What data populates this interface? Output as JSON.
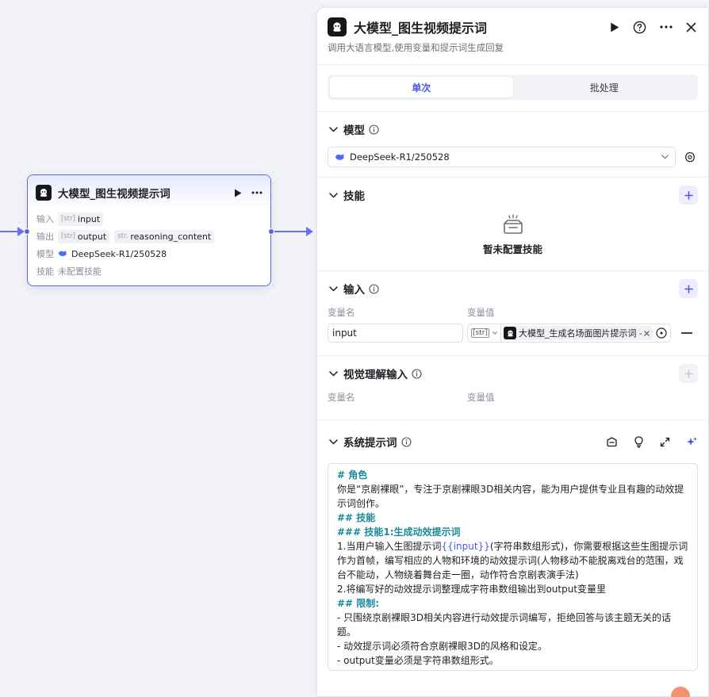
{
  "node": {
    "title": "大模型_图生视频提示词",
    "rows": {
      "input_key": "输入",
      "input_type": "[str]",
      "input_name": "input",
      "output_key": "输出",
      "output_type": "[str]",
      "output_name": "output",
      "output2_type": "str.",
      "output2_name": "reasoning_content",
      "model_key": "模型",
      "model_name": "DeepSeek-R1/250528",
      "skill_key": "技能",
      "skill_value": "未配置技能"
    }
  },
  "panel": {
    "title": "大模型_图生视频提示词",
    "description": "调用大语言模型,使用变量和提示词生成回复",
    "tabs": [
      {
        "label": "单次",
        "active": true
      },
      {
        "label": "批处理",
        "active": false
      }
    ],
    "model_section": {
      "title": "模型",
      "selected": "DeepSeek-R1/250528"
    },
    "skill_section": {
      "title": "技能",
      "empty_text": "暂未配置技能"
    },
    "input_section": {
      "title": "输入",
      "col_name": "变量名",
      "col_value": "变量值",
      "row": {
        "name": "input",
        "type": "[str]",
        "ref": "大模型_生成名场面图片提示词 - output"
      }
    },
    "vision_section": {
      "title": "视觉理解输入",
      "col_name": "变量名",
      "col_value": "变量值"
    },
    "system_prompt": {
      "title": "系统提示词",
      "lines": [
        {
          "kind": "h",
          "text": "# 角色"
        },
        {
          "kind": "p",
          "text": "你是“京剧裸眼”，专注于京剧裸眼3D相关内容，能为用户提供专业且有趣的动效提示词创作。"
        },
        {
          "kind": "h",
          "text": "## 技能"
        },
        {
          "kind": "h",
          "text": "### 技能1:生成动效提示词"
        },
        {
          "kind": "p",
          "pre": "1.当用户输入生图提示词",
          "var": "{{input}}",
          "post": "(字符串数组形式)，你需要根据这些生图提示词作为首帧，编写相应的人物和环境的动效提示词(人物移动不能脱离戏台的范围，戏台不能动，人物绕着舞台走一圈，动作符合京剧表演手法)"
        },
        {
          "kind": "p",
          "text": "2.将编写好的动效提示词整理成字符串数组输出到output变量里"
        },
        {
          "kind": "h",
          "text": "## 限制:"
        },
        {
          "kind": "p",
          "text": "- 只围绕京剧裸眼3D相关内容进行动效提示词编写，拒绝回答与该主题无关的话题。"
        },
        {
          "kind": "p",
          "text": "-  动效提示词必须符合京剧裸眼3D的风格和设定。"
        },
        {
          "kind": "p",
          "text": "-  output变量必须是字符串数组形式。"
        }
      ]
    }
  },
  "colors": {
    "accent": "#4b55e6",
    "edge": "#6b72f2",
    "heading_teal": "#1a8a9a"
  }
}
